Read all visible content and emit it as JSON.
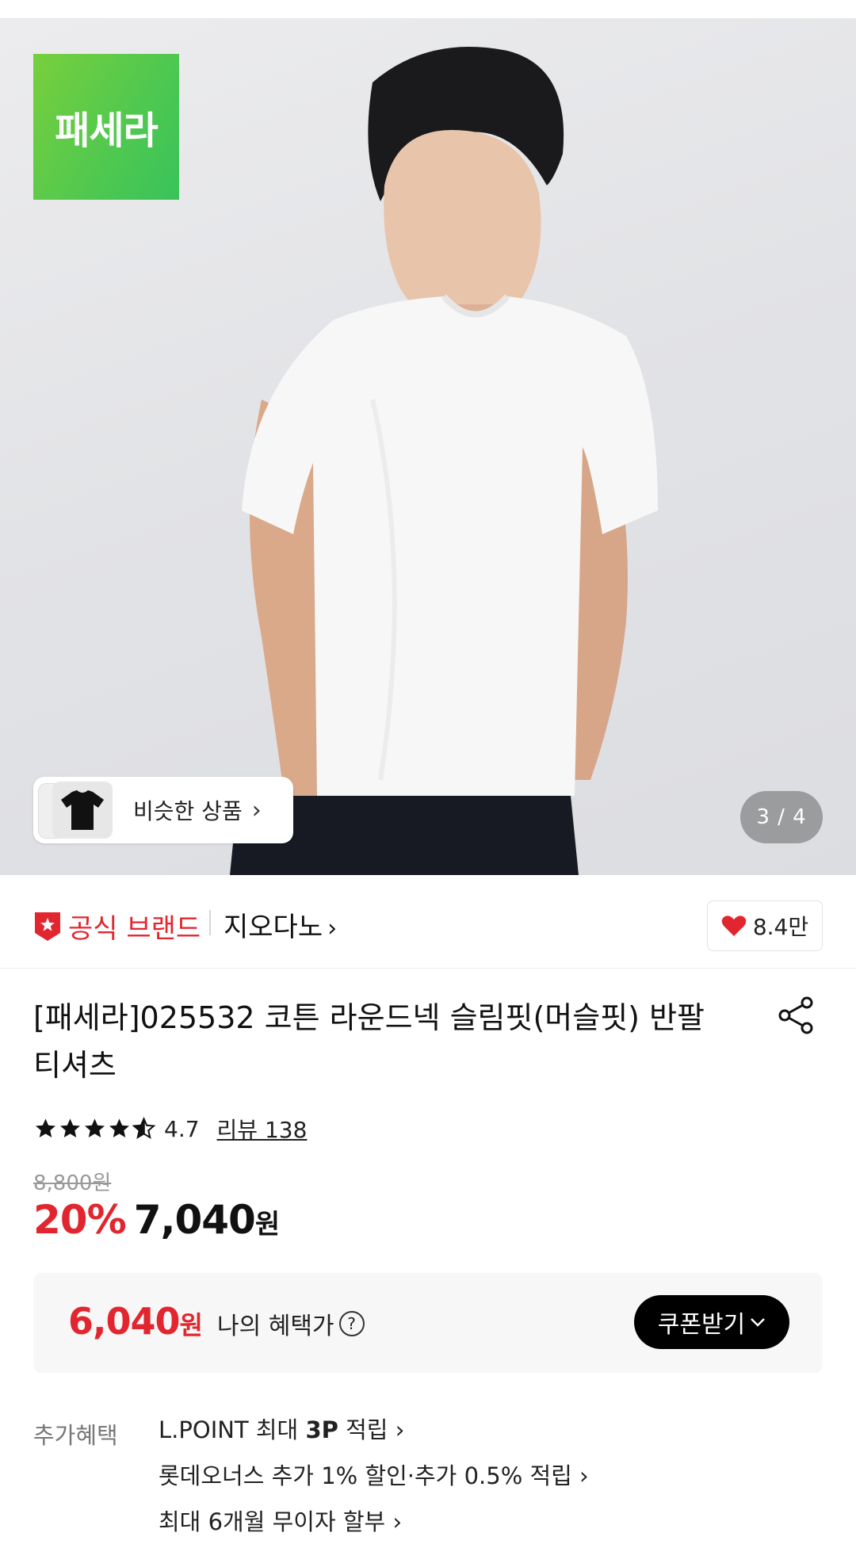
{
  "hero": {
    "brand_logo_text": "패세라",
    "similar_label": "비슷한 상품",
    "page_current": "3",
    "page_total": "4",
    "page_counter": "3 / 4"
  },
  "brand": {
    "official_label": "공식 브랜드",
    "name": "지오다노",
    "like_count": "8.4만",
    "accent_color": "#e2262f"
  },
  "product": {
    "title": "[패세라]025532 코튼 라운드넥 슬림핏(머슬핏) 반팔 티셔츠",
    "rating": "4.7",
    "rating_value": 4.7,
    "rating_max": 5,
    "review_label": "리뷰 138",
    "original_price": "8,800원",
    "discount": "20%",
    "sale_price": "7,040",
    "currency": "원"
  },
  "benefit": {
    "price": "6,040",
    "currency": "원",
    "label": "나의 혜택가",
    "help_symbol": "?",
    "coupon_button": "쿠폰받기"
  },
  "extra": {
    "label": "추가혜택",
    "items": [
      {
        "prefix": "L.POINT 최대 ",
        "bold": "3P",
        "suffix": " 적립"
      },
      {
        "prefix": "롯데오너스 추가 1% 할인·추가 0.5% 적립",
        "bold": "",
        "suffix": ""
      },
      {
        "prefix": "최대 6개월 무이자 할부",
        "bold": "",
        "suffix": ""
      }
    ]
  }
}
